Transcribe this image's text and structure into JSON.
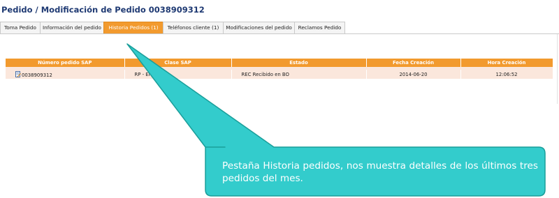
{
  "page": {
    "title": "Pedido / Modificación de Pedido 0038909312"
  },
  "tabs": [
    {
      "label": "Toma Pedido",
      "active": false
    },
    {
      "label": "Información del pedido",
      "active": false
    },
    {
      "label": "Historia Pedidos (1)",
      "active": true
    },
    {
      "label": "Teléfonos cliente (1)",
      "active": false
    },
    {
      "label": "Modificaciones del pedido",
      "active": false
    },
    {
      "label": "Reclamos Pedido",
      "active": false
    }
  ],
  "table": {
    "headers": [
      "Número pedido SAP",
      "Clase SAP",
      "Estado",
      "Fecha Creación",
      "Hora Creación"
    ],
    "rows": [
      {
        "icon": "document-edit-icon",
        "numero": "0038909312",
        "clase": "RP - Envasado",
        "estado": "REC Recibido en BO",
        "fecha": "2014-06-20",
        "hora": "12:06:52"
      }
    ]
  },
  "callout": {
    "text": "Pestaña Historia pedidos, nos muestra detalles de los últimos tres pedidos del mes.",
    "fill": "#33cccc",
    "stroke": "#1a9e9a"
  },
  "colors": {
    "accent": "#f29a2e",
    "row_bg": "#fbe7dc",
    "title": "#1f3a73"
  }
}
